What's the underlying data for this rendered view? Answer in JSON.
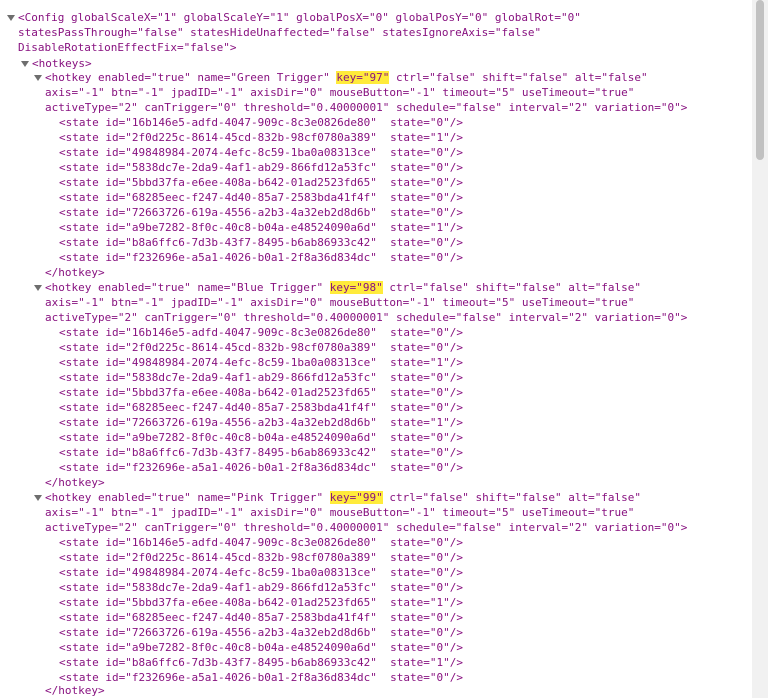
{
  "config": {
    "open_l1": "<Config globalScaleX=\"1\" globalScaleY=\"1\" globalPosX=\"0\" globalPosY=\"0\" globalRot=\"0\"",
    "open_l2": "statesPassThrough=\"false\" statesHideUnaffected=\"false\" statesIgnoreAxis=\"false\"",
    "open_l3": "DisableRotationEffectFix=\"false\">"
  },
  "hotkeys_open": "<hotkeys>",
  "hotkey_close": "</hotkey>",
  "blocks": [
    {
      "pre": "<hotkey enabled=\"true\" name=\"Green Trigger\" ",
      "key": "key=\"97\"",
      "post": " ctrl=\"false\" shift=\"false\" alt=\"false\"",
      "l2": "axis=\"-1\" btn=\"-1\" jpadID=\"-1\" axisDir=\"0\" mouseButton=\"-1\" timeout=\"5\" useTimeout=\"true\"",
      "l3": "activeType=\"2\" canTrigger=\"0\" threshold=\"0.40000001\" schedule=\"false\" interval=\"2\" variation=\"0\">",
      "states": [
        "<state id=\"16b146e5-adfd-4047-909c-8c3e0826de80\"  state=\"0\"/>",
        "<state id=\"2f0d225c-8614-45cd-832b-98cf0780a389\"  state=\"1\"/>",
        "<state id=\"49848984-2074-4efc-8c59-1ba0a08313ce\"  state=\"0\"/>",
        "<state id=\"5838dc7e-2da9-4af1-ab29-866fd12a53fc\"  state=\"0\"/>",
        "<state id=\"5bbd37fa-e6ee-408a-b642-01ad2523fd65\"  state=\"0\"/>",
        "<state id=\"68285eec-f247-4d40-85a7-2583bda41f4f\"  state=\"0\"/>",
        "<state id=\"72663726-619a-4556-a2b3-4a32eb2d8d6b\"  state=\"0\"/>",
        "<state id=\"a9be7282-8f0c-40c8-b04a-e48524090a6d\"  state=\"1\"/>",
        "<state id=\"b8a6ffc6-7d3b-43f7-8495-b6ab86933c42\"  state=\"0\"/>",
        "<state id=\"f232696e-a5a1-4026-b0a1-2f8a36d834dc\"  state=\"0\"/>"
      ]
    },
    {
      "pre": "<hotkey enabled=\"true\" name=\"Blue Trigger\" ",
      "key": "key=\"98\"",
      "post": " ctrl=\"false\" shift=\"false\" alt=\"false\"",
      "l2": "axis=\"-1\" btn=\"-1\" jpadID=\"-1\" axisDir=\"0\" mouseButton=\"-1\" timeout=\"5\" useTimeout=\"true\"",
      "l3": "activeType=\"2\" canTrigger=\"0\" threshold=\"0.40000001\" schedule=\"false\" interval=\"2\" variation=\"0\">",
      "states": [
        "<state id=\"16b146e5-adfd-4047-909c-8c3e0826de80\"  state=\"0\"/>",
        "<state id=\"2f0d225c-8614-45cd-832b-98cf0780a389\"  state=\"0\"/>",
        "<state id=\"49848984-2074-4efc-8c59-1ba0a08313ce\"  state=\"1\"/>",
        "<state id=\"5838dc7e-2da9-4af1-ab29-866fd12a53fc\"  state=\"0\"/>",
        "<state id=\"5bbd37fa-e6ee-408a-b642-01ad2523fd65\"  state=\"0\"/>",
        "<state id=\"68285eec-f247-4d40-85a7-2583bda41f4f\"  state=\"0\"/>",
        "<state id=\"72663726-619a-4556-a2b3-4a32eb2d8d6b\"  state=\"1\"/>",
        "<state id=\"a9be7282-8f0c-40c8-b04a-e48524090a6d\"  state=\"0\"/>",
        "<state id=\"b8a6ffc6-7d3b-43f7-8495-b6ab86933c42\"  state=\"0\"/>",
        "<state id=\"f232696e-a5a1-4026-b0a1-2f8a36d834dc\"  state=\"0\"/>"
      ]
    },
    {
      "pre": "<hotkey enabled=\"true\" name=\"Pink Trigger\" ",
      "key": "key=\"99\"",
      "post": " ctrl=\"false\" shift=\"false\" alt=\"false\"",
      "l2": "axis=\"-1\" btn=\"-1\" jpadID=\"-1\" axisDir=\"0\" mouseButton=\"-1\" timeout=\"5\" useTimeout=\"true\"",
      "l3": "activeType=\"2\" canTrigger=\"0\" threshold=\"0.40000001\" schedule=\"false\" interval=\"2\" variation=\"0\">",
      "states": [
        "<state id=\"16b146e5-adfd-4047-909c-8c3e0826de80\"  state=\"0\"/>",
        "<state id=\"2f0d225c-8614-45cd-832b-98cf0780a389\"  state=\"0\"/>",
        "<state id=\"49848984-2074-4efc-8c59-1ba0a08313ce\"  state=\"0\"/>",
        "<state id=\"5838dc7e-2da9-4af1-ab29-866fd12a53fc\"  state=\"0\"/>",
        "<state id=\"5bbd37fa-e6ee-408a-b642-01ad2523fd65\"  state=\"1\"/>",
        "<state id=\"68285eec-f247-4d40-85a7-2583bda41f4f\"  state=\"0\"/>",
        "<state id=\"72663726-619a-4556-a2b3-4a32eb2d8d6b\"  state=\"0\"/>",
        "<state id=\"a9be7282-8f0c-40c8-b04a-e48524090a6d\"  state=\"0\"/>",
        "<state id=\"b8a6ffc6-7d3b-43f7-8495-b6ab86933c42\"  state=\"1\"/>",
        "<state id=\"f232696e-a5a1-4026-b0a1-2f8a36d834dc\"  state=\"0\"/>"
      ]
    }
  ],
  "colors": {
    "tag": "#881280",
    "highlight": "#ffeb3b",
    "toggle": "#6e6e6e"
  },
  "icons": {
    "toggle": "triangle-down-icon"
  }
}
